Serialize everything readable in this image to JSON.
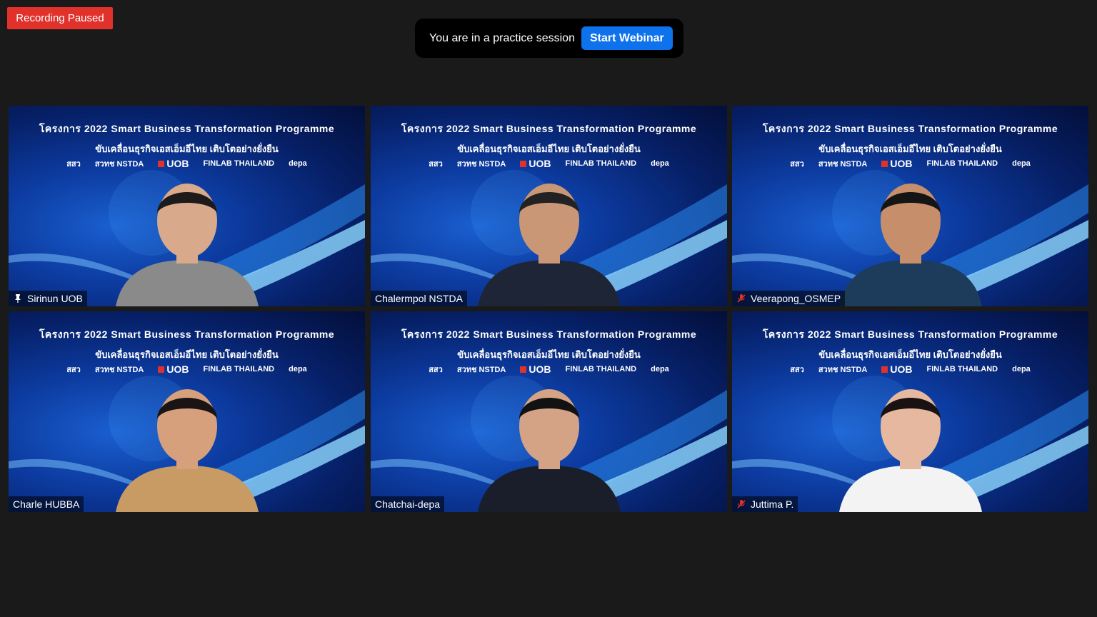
{
  "recording": {
    "label": "Recording Paused"
  },
  "practice": {
    "message": "You are in a practice session",
    "button_label": "Start Webinar"
  },
  "banner": {
    "title": "โครงการ 2022 Smart Business Transformation Programme",
    "subtitle": "ขับเคลื่อนธุรกิจเอสเอ็มอีไทย เติบโตอย่างยั่งยืน",
    "logos": [
      "สสว",
      "สวทช NSTDA",
      "UOB",
      "FINLAB THAILAND",
      "depa"
    ]
  },
  "participants": [
    {
      "name": "Sirinun UOB",
      "status_icon": "pin-icon",
      "skin": "#d8a98a",
      "hair": "#1c1a1a",
      "shirt": "#8a8a8a"
    },
    {
      "name": "Chalermpol NSTDA",
      "status_icon": "",
      "skin": "#c99676",
      "hair": "#222",
      "shirt": "#1e2536"
    },
    {
      "name": "Veerapong_OSMEP",
      "status_icon": "mic-muted-icon",
      "skin": "#c78e6c",
      "hair": "#151515",
      "shirt": "#1d3b5a"
    },
    {
      "name": "Charle HUBBA",
      "status_icon": "",
      "skin": "#d6a07c",
      "hair": "#1a1514",
      "shirt": "#c89b65"
    },
    {
      "name": "Chatchai-depa",
      "status_icon": "",
      "skin": "#d4a386",
      "hair": "#121212",
      "shirt": "#1a1e2a"
    },
    {
      "name": "Juttima P.",
      "status_icon": "mic-muted-icon",
      "skin": "#e6b8a0",
      "hair": "#1a1212",
      "shirt": "#f3f3f3"
    }
  ],
  "colors": {
    "recording_red": "#e0312b",
    "start_button_blue": "#0e72ed",
    "mute_red": "#e0312b"
  }
}
